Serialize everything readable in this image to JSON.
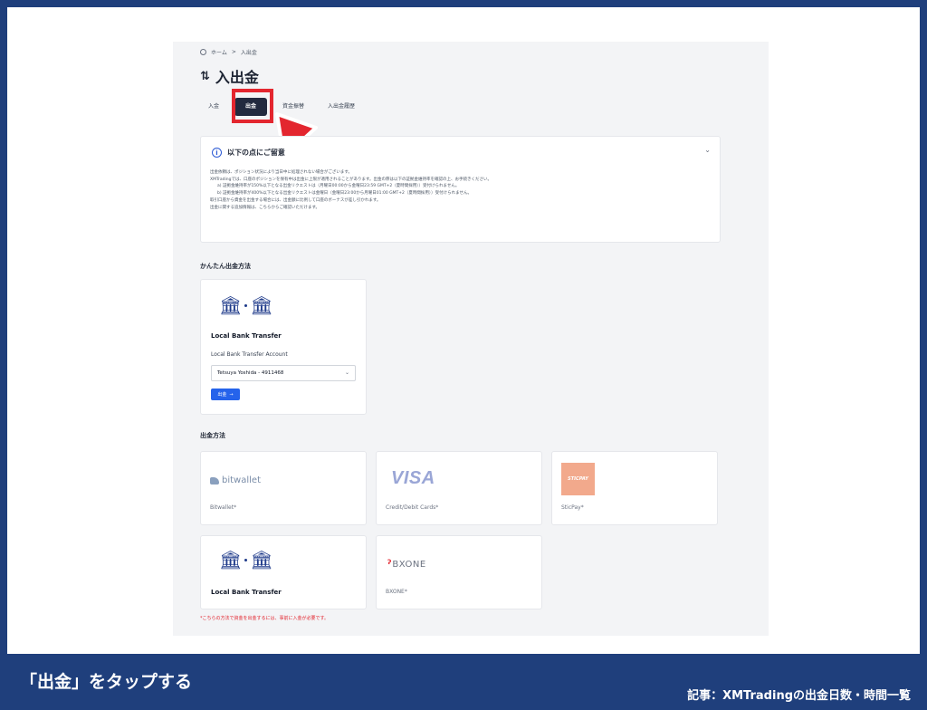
{
  "breadcrumb": {
    "home": "ホーム",
    "separator": ">",
    "current": "入出金"
  },
  "page": {
    "title": "入出金",
    "title_icon": "swap-arrows-icon"
  },
  "tabs": [
    {
      "label": "入金",
      "active": false
    },
    {
      "label": "出金",
      "active": true
    },
    {
      "label": "資金振替",
      "active": false
    },
    {
      "label": "入出金履歴",
      "active": false
    }
  ],
  "notice": {
    "title": "以下の点にご留意",
    "lines": [
      "出金依頼は、ポジション状況により当日中に処理されない場合がございます。",
      "XMTradingでは、口座のポジションを保有中は出金に上限が適用されることがあります。出金の際は以下の証拠金維持率を確認の上、お手続きください。",
      "a) 証拠金維持率が150%以下となる出金リクエストは（月曜日00:00から金曜日23:59 GMT+2（夏時間採用））受付けられません。",
      "b) 証拠金維持率が400%以下となる出金リクエストは金曜日（金曜日23:00から月曜日01:00 GMT+2（夏時間採用））受付けられません。",
      "取引口座から資金を出金する場合には、出金額に比例して口座のボーナスが差し引かれます。",
      "出金に関する追加情報は、こちらからご確認いただけます。"
    ]
  },
  "quick_section": {
    "label": "かんたん出金方法",
    "card": {
      "name": "Local Bank Transfer",
      "account_label": "Local Bank Transfer Account",
      "selected_account": "Tetsuya Yoshida - 4911468",
      "button_label": "出金"
    }
  },
  "methods_section": {
    "label": "出金方法",
    "methods": [
      {
        "name": "Bitwallet*",
        "logo_text": "bitwallet"
      },
      {
        "name": "Credit/Debit Cards*",
        "logo_text": "VISA"
      },
      {
        "name": "SticPay*",
        "logo_text": "STICPAY"
      },
      {
        "name": "Local Bank Transfer"
      },
      {
        "name": "BXONE*",
        "logo_text": "BXONE"
      }
    ],
    "footnote": "*こちらの方法で資金を出金するには、事前に入金が必要です。"
  },
  "caption": "「出金」をタップする",
  "article_ref": "記事：XMTradingの出金日数・時間一覧",
  "colors": {
    "accent": "#2563eb",
    "highlight": "#e3262f",
    "bottom_bar": "#1f3f7c",
    "active_tab": "#222a3f"
  }
}
